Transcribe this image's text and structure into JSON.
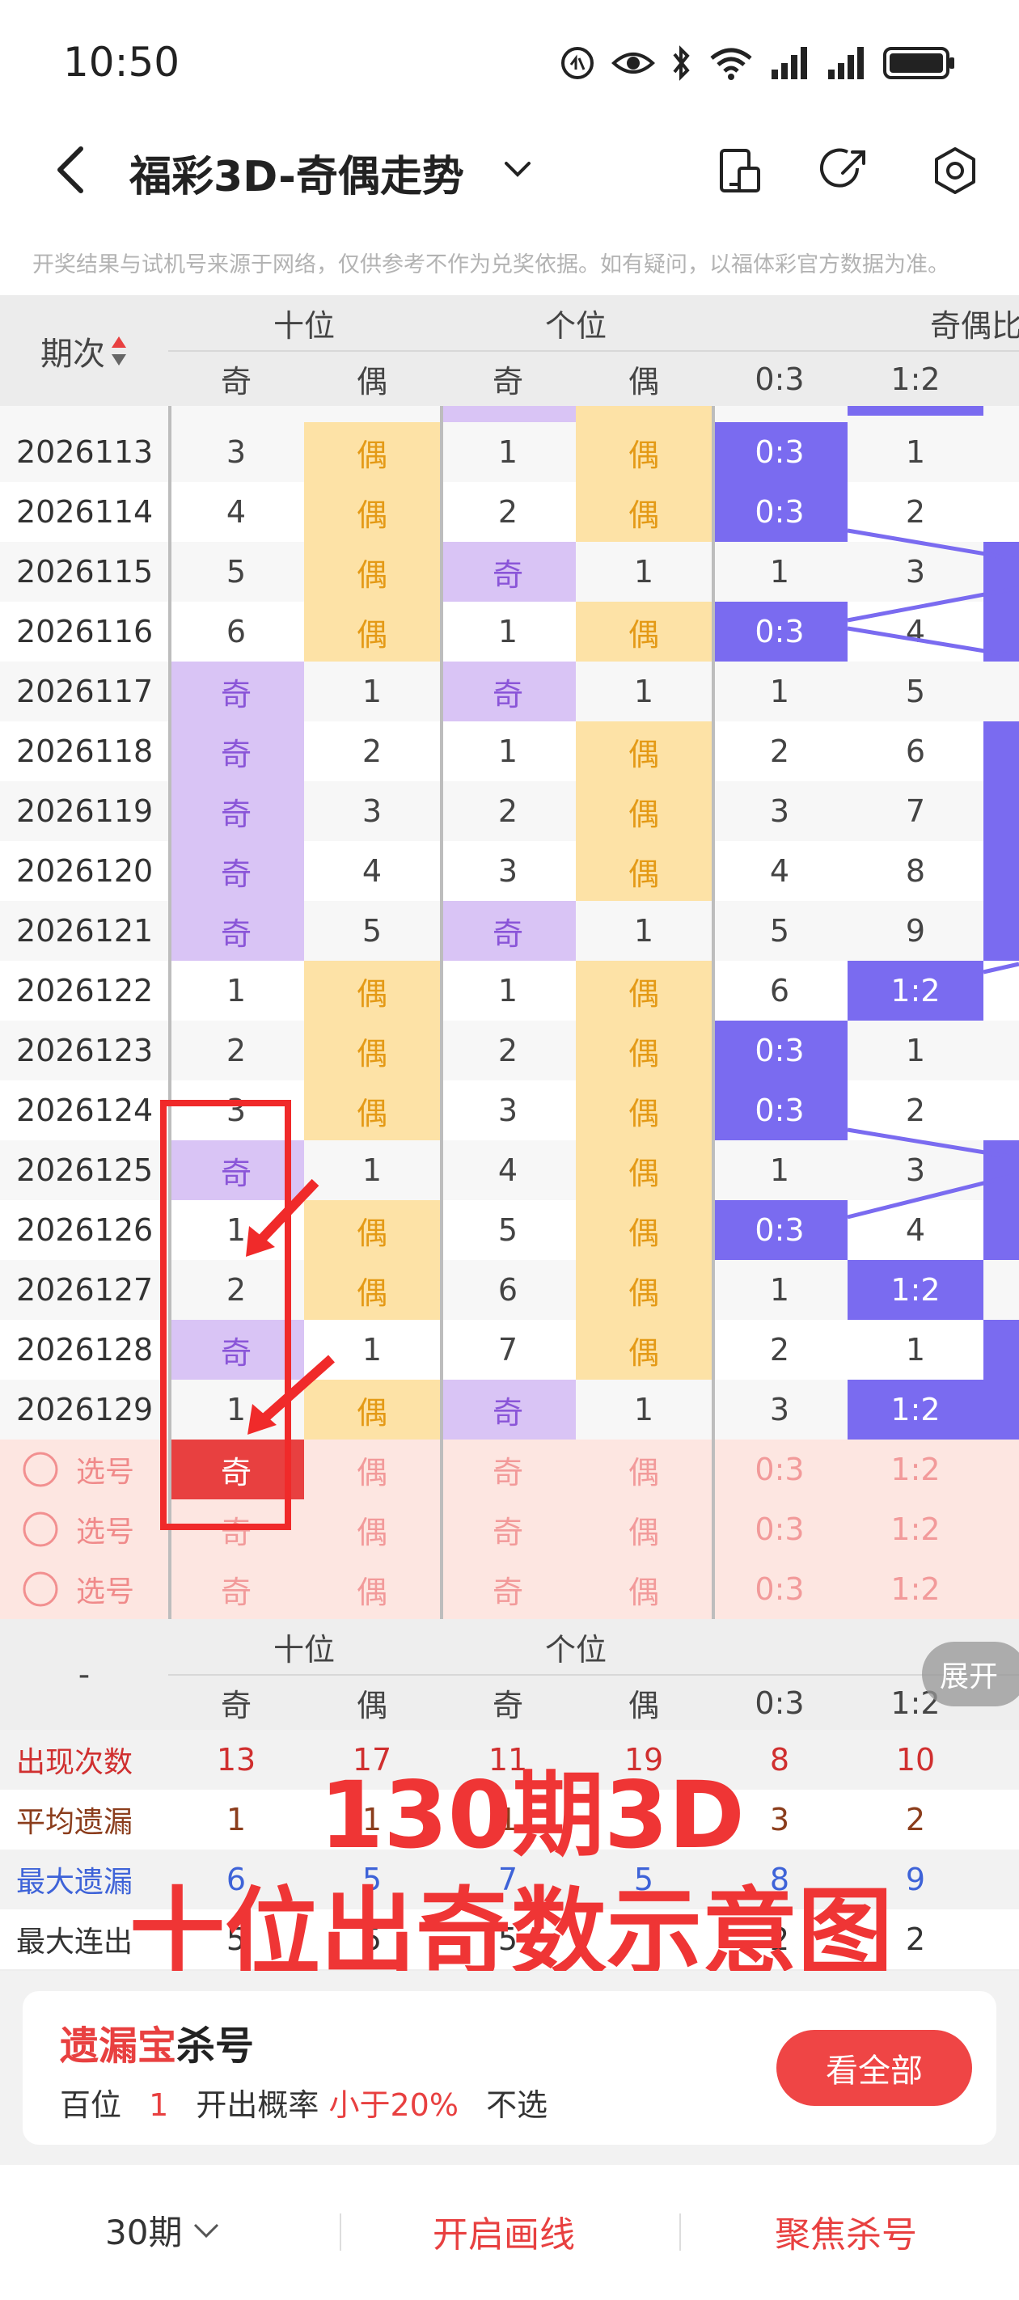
{
  "status": {
    "time": "10:50"
  },
  "header": {
    "title": "福彩3D-奇偶走势"
  },
  "notice": "开奖结果与试机号来源于网络，仅供参考不作为兑奖依据。如有疑问，以福体彩官方数据为准。",
  "table": {
    "period_header": "期次",
    "groups": [
      "十位",
      "个位",
      "奇偶比"
    ],
    "subheaders": [
      "奇",
      "偶",
      "奇",
      "偶",
      "0:3",
      "1:2"
    ],
    "rows": [
      {
        "p": "2026113",
        "v": [
          "3",
          "偶",
          "1",
          "偶",
          "0:3",
          "1"
        ]
      },
      {
        "p": "2026114",
        "v": [
          "4",
          "偶",
          "2",
          "偶",
          "0:3",
          "2"
        ]
      },
      {
        "p": "2026115",
        "v": [
          "5",
          "偶",
          "奇",
          "1",
          "1",
          "3"
        ]
      },
      {
        "p": "2026116",
        "v": [
          "6",
          "偶",
          "1",
          "偶",
          "0:3",
          "4"
        ]
      },
      {
        "p": "2026117",
        "v": [
          "奇",
          "1",
          "奇",
          "1",
          "1",
          "5"
        ]
      },
      {
        "p": "2026118",
        "v": [
          "奇",
          "2",
          "1",
          "偶",
          "2",
          "6"
        ]
      },
      {
        "p": "2026119",
        "v": [
          "奇",
          "3",
          "2",
          "偶",
          "3",
          "7"
        ]
      },
      {
        "p": "2026120",
        "v": [
          "奇",
          "4",
          "3",
          "偶",
          "4",
          "8"
        ]
      },
      {
        "p": "2026121",
        "v": [
          "奇",
          "5",
          "奇",
          "1",
          "5",
          "9"
        ]
      },
      {
        "p": "2026122",
        "v": [
          "1",
          "偶",
          "1",
          "偶",
          "6",
          "1:2"
        ]
      },
      {
        "p": "2026123",
        "v": [
          "2",
          "偶",
          "2",
          "偶",
          "0:3",
          "1"
        ]
      },
      {
        "p": "2026124",
        "v": [
          "3",
          "偶",
          "3",
          "偶",
          "0:3",
          "2"
        ]
      },
      {
        "p": "2026125",
        "v": [
          "奇",
          "1",
          "4",
          "偶",
          "1",
          "3"
        ]
      },
      {
        "p": "2026126",
        "v": [
          "1",
          "偶",
          "5",
          "偶",
          "0:3",
          "4"
        ]
      },
      {
        "p": "2026127",
        "v": [
          "2",
          "偶",
          "6",
          "偶",
          "1",
          "1:2"
        ]
      },
      {
        "p": "2026128",
        "v": [
          "奇",
          "1",
          "7",
          "偶",
          "2",
          "1"
        ]
      },
      {
        "p": "2026129",
        "v": [
          "1",
          "偶",
          "奇",
          "1",
          "3",
          "1:2"
        ]
      }
    ],
    "select_label": "选号",
    "select_values": [
      "奇",
      "偶",
      "奇",
      "偶",
      "0:3",
      "1:2"
    ],
    "stats": {
      "dash": "-",
      "expand": "展开",
      "rows": [
        {
          "label": "出现次数",
          "values": [
            "13",
            "17",
            "11",
            "19",
            "8",
            "10"
          ],
          "color": "#d02f2f"
        },
        {
          "label": "平均遗漏",
          "values": [
            "1",
            "1",
            "1",
            "",
            "3",
            "2"
          ],
          "color": "#8b3d1c"
        },
        {
          "label": "最大遗漏",
          "values": [
            "6",
            "5",
            "7",
            "5",
            "8",
            "9"
          ],
          "color": "#3e63d8"
        },
        {
          "label": "最大连出",
          "values": [
            "5",
            "5",
            "5",
            "",
            "2",
            "2"
          ],
          "color": "#333333"
        }
      ]
    }
  },
  "overlay": {
    "line1": "130期3D",
    "line2": "十位出奇数示意图"
  },
  "promo": {
    "title_red": "遗漏宝",
    "title_rest": "杀号",
    "position": "百位",
    "number": "1",
    "prob_label": "开出概率",
    "prob_value": "小于20%",
    "action_text": "不选",
    "button": "看全部"
  },
  "bottom": {
    "period_select": "30期",
    "draw_lines": "开启画线",
    "focus_kill": "聚焦杀号"
  },
  "colors": {
    "odd_bg": "#d9c4f5",
    "even_bg": "#fde2a6",
    "ratio_bg": "#7a6bf0",
    "red": "#e84040"
  }
}
